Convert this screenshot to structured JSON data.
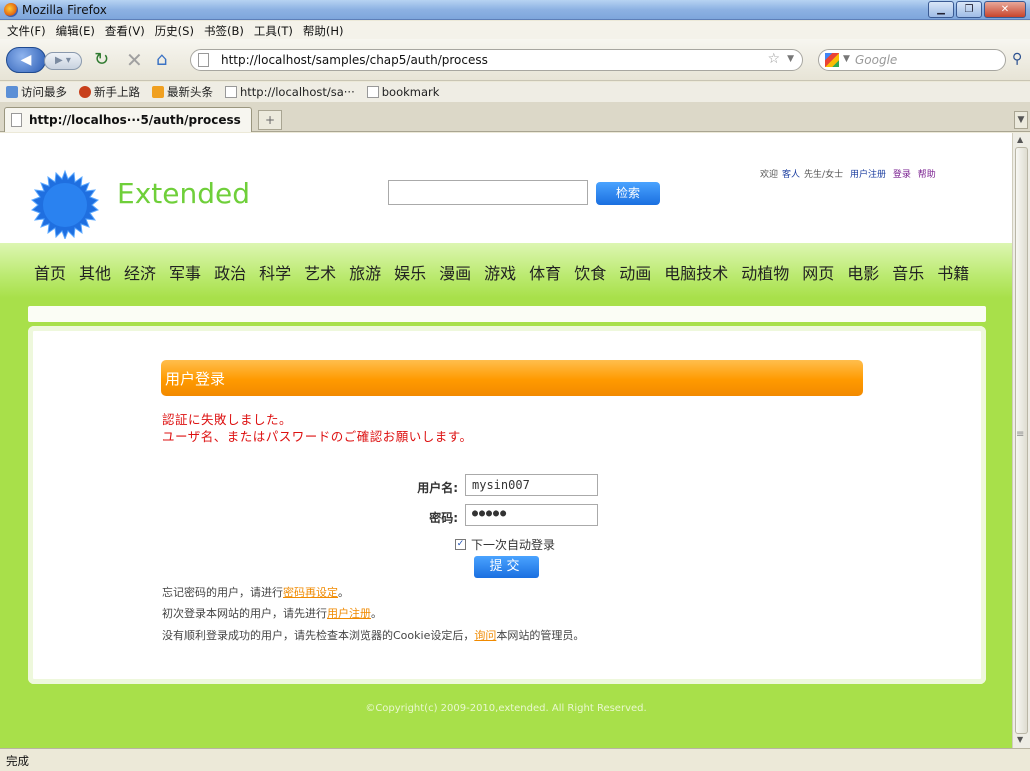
{
  "window": {
    "title": "Mozilla Firefox",
    "buttons": {
      "minimize": "▁",
      "maximize": "❐",
      "close": "✕"
    }
  },
  "menu": [
    "文件(F)",
    "编辑(E)",
    "查看(V)",
    "历史(S)",
    "书签(B)",
    "工具(T)",
    "帮助(H)"
  ],
  "navbar": {
    "url": "http://localhost/samples/chap5/auth/process",
    "search_placeholder": "Google",
    "icons": {
      "back": "back-arrow",
      "forward": "forward-arrow",
      "reload": "reload",
      "stop": "stop",
      "home": "home"
    }
  },
  "bookmarks": [
    {
      "label": "访问最多",
      "icon": "mv"
    },
    {
      "label": "新手上路",
      "icon": "ff"
    },
    {
      "label": "最新头条",
      "icon": "rss"
    },
    {
      "label": "http://localhost/sa···",
      "icon": "page"
    },
    {
      "label": "bookmark",
      "icon": "page"
    }
  ],
  "tab": {
    "title": "http://localhos···5/auth/process",
    "new_tab": "+"
  },
  "site": {
    "logo_text": "Extended",
    "search_button": "检索",
    "user_links": {
      "welcome": "欢迎",
      "guest": "客人",
      "honorific": "先生/女士",
      "register": "用户注册",
      "login": "登录",
      "help": "帮助"
    },
    "nav": [
      "首页",
      "其他",
      "经济",
      "军事",
      "政治",
      "科学",
      "艺术",
      "旅游",
      "娱乐",
      "漫画",
      "游戏",
      "体育",
      "饮食",
      "动画",
      "电脑技术",
      "动植物",
      "网页",
      "电影",
      "音乐",
      "书籍"
    ]
  },
  "login": {
    "title": "用户登录",
    "errors": [
      "認証に失敗しました。",
      "ユーザ名、またはパスワードのご確認お願いします。"
    ],
    "username_label": "用户名:",
    "username_value": "mysin007",
    "password_label": "密码:",
    "password_value": "●●●●●",
    "remember_label": "下一次自动登录",
    "remember_checked": true,
    "submit_label": "提交",
    "notes": {
      "forgot_prefix": "忘记密码的用户，请进行",
      "forgot_link": "密码再设定",
      "forgot_suffix": "。",
      "first_prefix": "初次登录本网站的用户，请先进行",
      "first_link": "用户注册",
      "first_suffix": "。",
      "fail_prefix": "没有顺利登录成功的用户，请先检查本浏览器的Cookie设定后，",
      "fail_link": "询问",
      "fail_suffix": "本网站的管理员。"
    }
  },
  "copyright": "©Copyright(c) 2009-2010,extended. All Right Reserved.",
  "status": "完成",
  "colors": {
    "brand_green": "#6fcf3a",
    "nav_green": "#a8e04a",
    "orange": "#ff9a00",
    "error_red": "#d11111",
    "button_blue": "#1a6fe0"
  }
}
